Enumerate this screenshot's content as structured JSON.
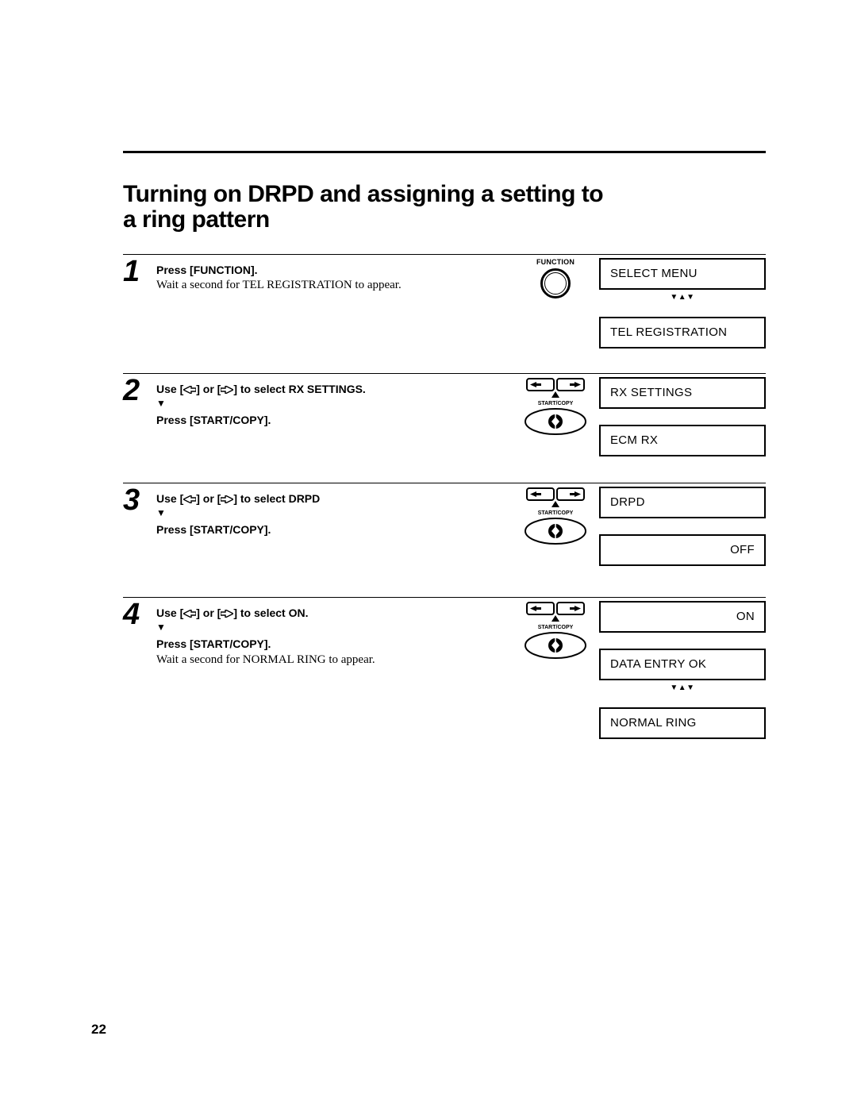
{
  "title": "Turning on DRPD and assigning a setting to a ring pattern",
  "page_number": "22",
  "steps": [
    {
      "num": "1",
      "line1": "Press [FUNCTION].",
      "line2": "",
      "extra": "Wait a second for TEL REGISTRATION to appear.",
      "button": "function",
      "displays": [
        {
          "text": "SELECT MENU",
          "align": "left",
          "hasSepAfter": true
        },
        {
          "text": "TEL REGISTRATION",
          "align": "left",
          "hasSepAfter": false
        }
      ]
    },
    {
      "num": "2",
      "compound_prefix": "Use [",
      "compound_mid": "] or [",
      "compound_suffix": "] to select RX SETTINGS.",
      "line2": "Press [START/COPY].",
      "extra": "",
      "button": "arrows",
      "displays": [
        {
          "text": "RX SETTINGS",
          "align": "left",
          "hasSepAfter": false
        },
        {
          "text": "ECM RX",
          "align": "left",
          "hasSepAfter": false
        }
      ]
    },
    {
      "num": "3",
      "compound_prefix": "Use [",
      "compound_mid": "] or [",
      "compound_suffix": "] to select DRPD",
      "line2": "Press [START/COPY].",
      "extra": "",
      "button": "arrows",
      "displays": [
        {
          "text": "DRPD",
          "align": "left",
          "hasSepAfter": false
        },
        {
          "text": "OFF",
          "align": "right",
          "hasSepAfter": false
        }
      ]
    },
    {
      "num": "4",
      "compound_prefix": "Use [",
      "compound_mid": "] or [",
      "compound_suffix": "] to select ON.",
      "line2": "Press [START/COPY].",
      "extra": "Wait a second for NORMAL RING to appear.",
      "button": "arrows",
      "displays": [
        {
          "text": "ON",
          "align": "right",
          "hasSepAfter": false
        },
        {
          "text": "DATA ENTRY OK",
          "align": "left",
          "hasSepAfter": true
        },
        {
          "text": "NORMAL RING",
          "align": "left",
          "hasSepAfter": false
        }
      ]
    }
  ],
  "icons": {
    "function_label": "FUNCTION",
    "startcopy_label": "START/COPY"
  }
}
